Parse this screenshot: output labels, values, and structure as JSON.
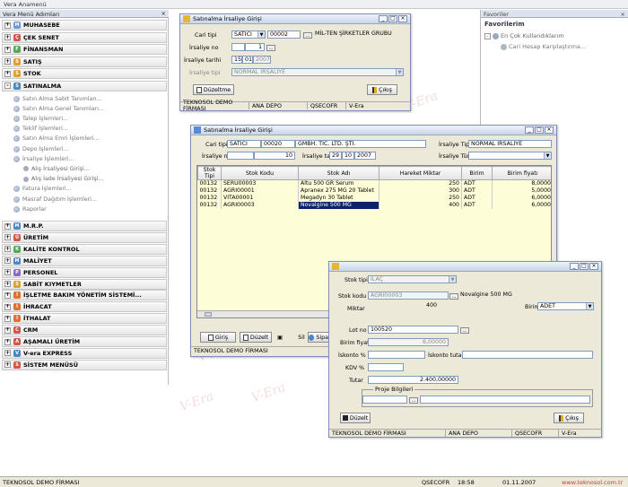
{
  "app": {
    "title": "Vera Anamenü"
  },
  "menu": {
    "header": "Vera Menü Adımları",
    "top_items": [
      {
        "label": "MUHASEBE",
        "sign": "+",
        "icon": "M",
        "color": "#6c9bd2"
      },
      {
        "label": "ÇEK SENET",
        "sign": "+",
        "icon": "Ç",
        "color": "#d0554a"
      },
      {
        "label": "FİNANSMAN",
        "sign": "+",
        "icon": "F",
        "color": "#5aa55a"
      },
      {
        "label": "SATIŞ",
        "sign": "+",
        "icon": "S",
        "color": "#e0a030"
      },
      {
        "label": "STOK",
        "sign": "+",
        "icon": "S",
        "color": "#e0a030"
      },
      {
        "label": "SATINALMA",
        "sign": "-",
        "icon": "S",
        "color": "#4a86c8"
      }
    ],
    "sub_items": [
      "Satın Alma Sabit Tanımları...",
      "Satın Alma Genel Tanımları...",
      "Talep İşlemleri...",
      "Teklif İşlemleri...",
      "Satın Alma Emri İşlemleri...",
      "Depo İşlemleri...",
      "İrsaliye İşlemleri..."
    ],
    "sub2_items": [
      "Alış İrsaliyesi Girişi...",
      "Alış İade İrsaliyesi Girişi..."
    ],
    "sub_items_after": [
      "Fatura İşlemleri...",
      "Masraf Dağıtım İşlemleri...",
      "Raporlar"
    ],
    "bottom_items": [
      {
        "label": "M.R.P.",
        "icon": "M",
        "color": "#4a86c8"
      },
      {
        "label": "ÜRETİM",
        "icon": "Ü",
        "color": "#d0554a"
      },
      {
        "label": "KALİTE KONTROL",
        "icon": "K",
        "color": "#5aa55a"
      },
      {
        "label": "MALİYET",
        "icon": "M",
        "color": "#4a86c8"
      },
      {
        "label": "PERSONEL",
        "icon": "P",
        "color": "#8a6ac8"
      },
      {
        "label": "SABİT KIYMETLER",
        "icon": "S",
        "color": "#e0a030"
      },
      {
        "label": "İŞLETME BAKIM YÖNETİM SİSTEMİ...",
        "icon": "İ",
        "color": "#e07030"
      },
      {
        "label": "İHRACAT",
        "icon": "İ",
        "color": "#e07030"
      },
      {
        "label": "İTHALAT",
        "icon": "İ",
        "color": "#e07030"
      },
      {
        "label": "CRM",
        "icon": "C",
        "color": "#d0554a"
      },
      {
        "label": "AŞAMALI ÜRETİM",
        "icon": "A",
        "color": "#d0554a"
      },
      {
        "label": "V-era EXPRESS",
        "icon": "V",
        "color": "#4a86c8"
      },
      {
        "label": "SİSTEM MENÜSÜ",
        "icon": "S",
        "color": "#d0554a"
      }
    ]
  },
  "favorites": {
    "header": "Favoriler",
    "title": "Favorilerim",
    "group": "En Çok Kullandıklarım",
    "item": "Cari Hesap Karşılaştırma..."
  },
  "win1": {
    "title": "Satınalma İrsaliye Girişi",
    "cari_tipi_label": "Cari tipi",
    "cari_tipi_value": "SATICI",
    "cari_code": "00002",
    "cari_name": "MİL-TEN ŞİRKETLER GRUBU",
    "irsaliye_no_label": "İrsaliye no",
    "irsaliye_no_value": "1",
    "irsaliye_tarihi_label": "İrsaliye tarihi",
    "day": "15",
    "month": "01",
    "year": "2007",
    "irsaliye_tipi_label": "İrsaliye tipi",
    "irsaliye_tipi_value": "NORMAL İRSALİYE",
    "edit_button": "Düzeltme",
    "exit_button": "Çıkış",
    "status": [
      "TEKNOSOL DEMO FİRMASI",
      "ANA DEPO",
      "QSECOFR",
      "V-Era"
    ]
  },
  "win2": {
    "title": "Satınalma İrsaliye Girişi",
    "cari_tipi_label": "Cari tipi",
    "cari_tipi_value": "SATICI",
    "cari_code": "00020",
    "cari_name": "GMBH. TİC. LTD. ŞTİ.",
    "irsaliye_tipi_label": "İrsaliye Tipi",
    "irsaliye_tipi_value": "NORMAL İRSALİYE",
    "irsaliye_no_label": "İrsaliye no",
    "irsaliye_no_value": "10",
    "irsaliye_tarihi_label": "İrsaliye tarihi",
    "day": "29",
    "month": "10",
    "year": "2007",
    "irsaliye_turu_label": "İrsaliye Türü",
    "columns": [
      "Stok Tipi",
      "Stok Kodu",
      "Stok Adı",
      "Hareket Miktar",
      "Birim",
      "Birim fiyatı"
    ],
    "rows": [
      [
        "00132",
        "SERU00003",
        "Altu 500 GR Serum",
        "250",
        "ADT",
        "8,0000"
      ],
      [
        "00132",
        "AGRI00001",
        "Apranex 275 MG 20 Tablet",
        "300",
        "ADT",
        "5,0000"
      ],
      [
        "00132",
        "VITA00001",
        "Megadyn 30 Tablet",
        "250",
        "ADT",
        "6,0000"
      ],
      [
        "00132",
        "AGRI00003",
        "Novalgine 500 MG",
        "400",
        "ADT",
        "6,0000"
      ]
    ],
    "buttons": [
      "Giriş",
      "Düzelt",
      "Sil",
      "Sipa"
    ],
    "status": "TEKNOSOL DEMO FİRMASI"
  },
  "win3": {
    "stok_tipi_label": "Stok tipi",
    "stok_tipi_value": "İLAÇ",
    "stok_kodu_label": "Stok kodu",
    "stok_kodu_value": "AGRI00003",
    "stok_name": "Novalgine 500 MG",
    "miktar_label": "Miktar",
    "miktar_value": "400",
    "birim_label": "Birim",
    "birim_value": "ADET",
    "lot_label": "Lot no",
    "lot_value": "100520",
    "birim_fiyat_label": "Birim fiyat",
    "birim_fiyat_value": "6,00000",
    "iskonto_pct_label": "İskonto %",
    "iskonto_tutar_label": "İskonto tutarı",
    "kdv_label": "KDV %",
    "tutar_label": "Tutar",
    "tutar_value": "2.400,00000",
    "proje_label": "Proje Bilgileri",
    "edit_button": "Düzelt",
    "exit_button": "Çıkış",
    "status": [
      "TEKNOSOL DEMO FİRMASI",
      "ANA DEPO",
      "QSECOFR",
      "V-Era"
    ]
  },
  "app_status": {
    "company": "TEKNOSOL DEMO FİRMASI",
    "user": "QSECOFR",
    "time": "18:58",
    "date": "01.11.2007",
    "url": "www.teknosol.com.tr"
  },
  "watermark": "V-Era"
}
